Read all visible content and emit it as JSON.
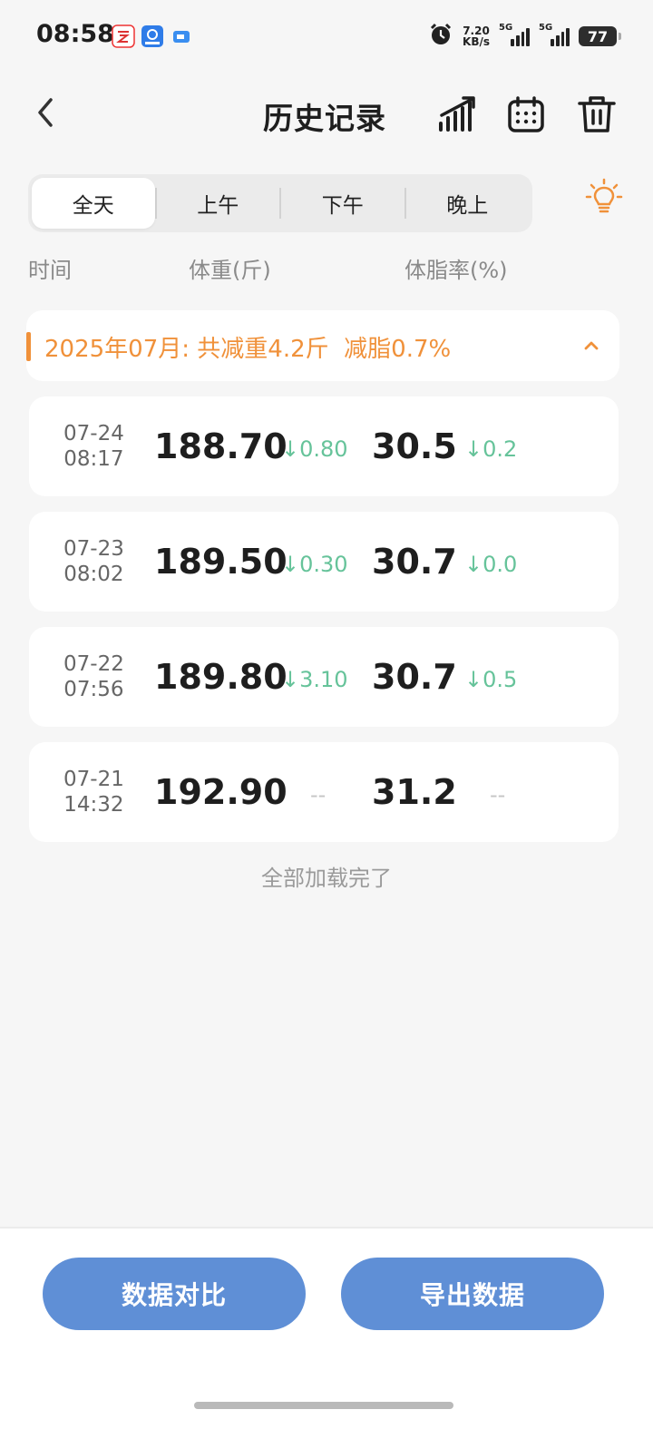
{
  "status_bar": {
    "time": "08:58",
    "net_speed_value": "7.20",
    "net_speed_unit": "KB/s",
    "signal1_label": "5G",
    "signal2_label": "5G",
    "battery": "77"
  },
  "header": {
    "title": "历史记录",
    "icons": [
      "back-icon",
      "trend-chart-icon",
      "calendar-icon",
      "trash-icon"
    ]
  },
  "tabs": [
    {
      "label": "全天",
      "active": true
    },
    {
      "label": "上午",
      "active": false
    },
    {
      "label": "下午",
      "active": false
    },
    {
      "label": "晚上",
      "active": false
    }
  ],
  "columns": {
    "time": "时间",
    "weight": "体重(斤)",
    "body_fat": "体脂率(%)"
  },
  "month_summary": {
    "text": "2025年07月: 共减重4.2斤  减脂0.7%",
    "accent_color": "#f0913a"
  },
  "records": [
    {
      "date": "07-24",
      "time": "08:17",
      "weight": "188.70",
      "weight_delta": "↓0.80",
      "fat": "30.5",
      "fat_delta": "↓0.2"
    },
    {
      "date": "07-23",
      "time": "08:02",
      "weight": "189.50",
      "weight_delta": "↓0.30",
      "fat": "30.7",
      "fat_delta": "↓0.0"
    },
    {
      "date": "07-22",
      "time": "07:56",
      "weight": "189.80",
      "weight_delta": "↓3.10",
      "fat": "30.7",
      "fat_delta": "↓0.5"
    },
    {
      "date": "07-21",
      "time": "14:32",
      "weight": "192.90",
      "weight_delta": "--",
      "fat": "31.2",
      "fat_delta": "--"
    }
  ],
  "footer_text": "全部加载完了",
  "buttons": {
    "compare": "数据对比",
    "export": "导出数据"
  },
  "colors": {
    "primary_button": "#5f8fd6",
    "delta_green": "#66c39a"
  }
}
